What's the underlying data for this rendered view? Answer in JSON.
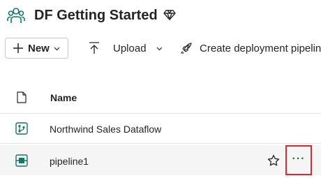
{
  "header": {
    "title": "DF Getting Started",
    "workspace_icon": "people-group-icon",
    "badge_icon": "diamond-icon"
  },
  "toolbar": {
    "new_label": "New",
    "upload_label": "Upload",
    "deploy_label": "Create deployment pipeline"
  },
  "table": {
    "column_headers": {
      "icon": "file-icon",
      "name": "Name"
    },
    "rows": [
      {
        "name": "Northwind Sales Dataflow",
        "icon": "dataflow-icon"
      },
      {
        "name": "pipeline1",
        "icon": "pipeline-icon",
        "actions": [
          "star-icon",
          "more-options"
        ],
        "more_label": "···"
      }
    ]
  },
  "colors": {
    "accent": "#117865",
    "highlight": "#e0262a",
    "text": "#242424",
    "selected_row": "#f5f5f5"
  }
}
